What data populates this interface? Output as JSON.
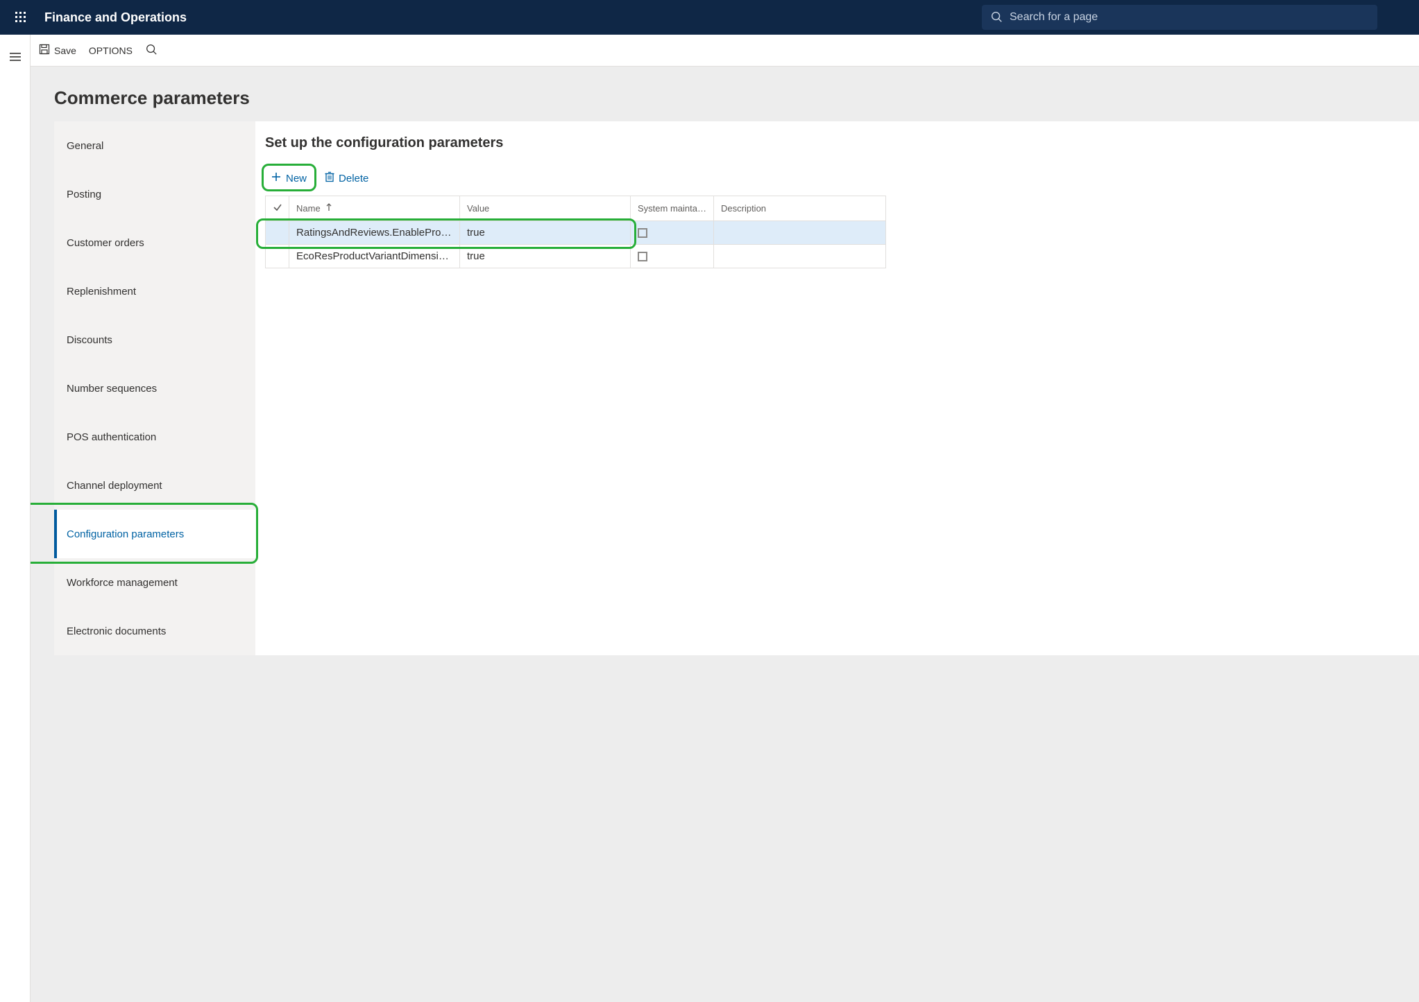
{
  "header": {
    "app_title": "Finance and Operations",
    "search_placeholder": "Search for a page"
  },
  "action_bar": {
    "save_label": "Save",
    "options_label": "OPTIONS"
  },
  "page": {
    "title": "Commerce parameters"
  },
  "sidebar": {
    "items": [
      {
        "label": "General",
        "selected": false
      },
      {
        "label": "Posting",
        "selected": false
      },
      {
        "label": "Customer orders",
        "selected": false
      },
      {
        "label": "Replenishment",
        "selected": false
      },
      {
        "label": "Discounts",
        "selected": false
      },
      {
        "label": "Number sequences",
        "selected": false
      },
      {
        "label": "POS authentication",
        "selected": false
      },
      {
        "label": "Channel deployment",
        "selected": false
      },
      {
        "label": "Configuration parameters",
        "selected": true
      },
      {
        "label": "Workforce management",
        "selected": false
      },
      {
        "label": "Electronic documents",
        "selected": false
      }
    ]
  },
  "right_panel": {
    "title": "Set up the configuration parameters",
    "toolbar": {
      "new_label": "New",
      "delete_label": "Delete"
    },
    "grid": {
      "columns": {
        "name": "Name",
        "value": "Value",
        "system": "System maintai...",
        "description": "Description"
      },
      "rows": [
        {
          "name": "RatingsAndReviews.EnableProd...",
          "value": "true",
          "system": false,
          "description": "",
          "selected": true
        },
        {
          "name": "EcoResProductVariantDimensio...",
          "value": "true",
          "system": false,
          "description": "",
          "selected": false
        }
      ]
    }
  }
}
